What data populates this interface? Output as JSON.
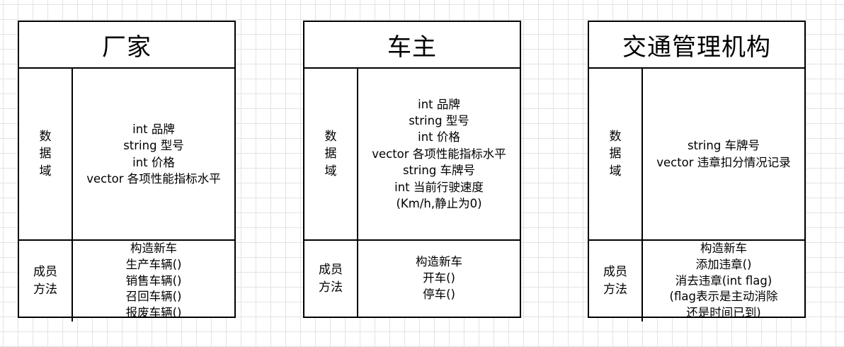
{
  "entities": [
    {
      "title": "厂家",
      "data_label": [
        "数",
        "据",
        "域"
      ],
      "data_items": [
        "int 品牌",
        "string 型号",
        "int 价格",
        "vector 各项性能指标水平"
      ],
      "methods_label": [
        "成员",
        "方法"
      ],
      "method_items": [
        "构造新车",
        "生产车辆()",
        "销售车辆()",
        "召回车辆()",
        "报废车辆()"
      ]
    },
    {
      "title": "车主",
      "data_label": [
        "数",
        "据",
        "域"
      ],
      "data_items": [
        "int 品牌",
        "string 型号",
        "int 价格",
        "vector 各项性能指标水平",
        "string 车牌号",
        "int 当前行驶速度",
        "(Km/h,静止为0)"
      ],
      "methods_label": [
        "成员",
        "方法"
      ],
      "method_items": [
        "构造新车",
        "开车()",
        "停车()"
      ]
    },
    {
      "title": "交通管理机构",
      "data_label": [
        "数",
        "据",
        "域"
      ],
      "data_items": [
        "string 车牌号",
        "vector 违章扣分情况记录"
      ],
      "methods_label": [
        "成员",
        "方法"
      ],
      "method_items": [
        "构造新车",
        "添加违章()",
        "消去违章(int flag)",
        "(flag表示是主动消除",
        "还是时间已到)"
      ]
    }
  ]
}
